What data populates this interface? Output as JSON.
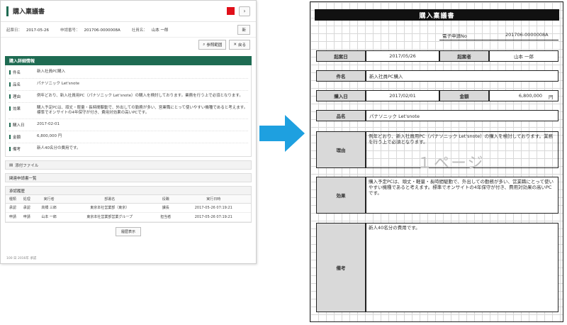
{
  "app": {
    "title": "購入稟議書",
    "meta": [
      {
        "key": "起票日：",
        "value": "2017-05-26"
      },
      {
        "key": "申請番号：",
        "value": "201706-0000008A"
      },
      {
        "key": "社員名：",
        "value": "山本 一郎"
      }
    ],
    "display_button": "新",
    "nav_next": "›",
    "tools": {
      "reference": "参照範囲",
      "back": "戻る"
    },
    "details_header": "購入詳細情報",
    "details": [
      {
        "key": "件名",
        "value": "新入社員PC購入"
      },
      {
        "key": "品名",
        "value": "パナソニック Let'snote"
      },
      {
        "key": "理由",
        "value": "例年どおり、新入社員用PC（パナソニック Let'snote）の購入を検討しております。業務を行う上で必須となります。"
      },
      {
        "key": "効果",
        "value": "購入予定PCは、頑丈・軽量・長時間駆動で、外出しての勤務が多い、営業職にとって使いやすい機種であると考えます。標準でオンサイトの4年保守が付き、費用対効果の高いPCです。"
      },
      {
        "key": "購入日",
        "value": "2017-02-01"
      },
      {
        "key": "金額",
        "value": "6,800,000 円"
      },
      {
        "key": "備考",
        "value": "新人40名分の費用です。"
      }
    ],
    "attachments": "添付ファイル",
    "related": "関連申請書一覧",
    "history": {
      "header": "承認履歴",
      "columns": [
        "種類",
        "処理",
        "実行者",
        "部署名",
        "役職",
        "実行日時"
      ],
      "rows": [
        [
          "承認",
          "承認",
          "高橋 三郎",
          "東京本社営業部（東京）",
          "課長",
          "2017-05-26 07:19:21"
        ],
        [
          "申請",
          "申請",
          "山本 一郎",
          "東京本社営業部営業グループ",
          "担当者",
          "2017-05-26 07:19:21"
        ]
      ]
    },
    "show_all": "履歴表示",
    "footer": "100 日 2016年 承認"
  },
  "sheet": {
    "title": "購入稟議書",
    "number_label": "電子申請No",
    "number_value": "201706-0000008A",
    "date_label": "起案日",
    "date_value": "2017/05/26",
    "drafter_label": "起案者",
    "drafter_value": "山本 一郎",
    "subject_label": "件名",
    "subject_value": "新入社員PC購入",
    "purchase_label": "購入日",
    "purchase_value": "2017/02/01",
    "amount_label": "金額",
    "amount_value": "6,800,000",
    "amount_unit": "円",
    "product_label": "品名",
    "product_value": "パナソニック Let'snote",
    "reason_label": "理由",
    "reason_value": "例年どおり、新入社員用PC（パナソニック Let'snote）の購入を検討しております。業務を行う上で必須となります。",
    "effect_label": "効果",
    "effect_value": "購入予定PCは、頑丈・軽量・長時間駆動で、外出しての勤務が多い、営業職にとって使いやすい機種であると考えます。標準でオンサイトの4年保守が付き、費用対効果の高いPCです。",
    "remarks_label": "備考",
    "remarks_value": "新人40名分の費用です。",
    "page_watermark": "１ページ"
  },
  "colors": {
    "accent": "#1e6b52",
    "arrow": "#1ea0e0",
    "red": "#e0101a"
  }
}
